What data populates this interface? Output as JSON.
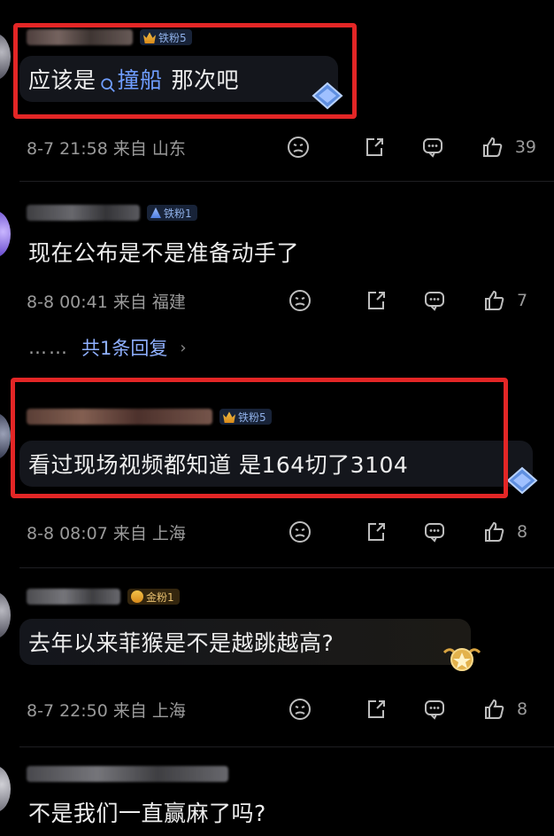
{
  "comments": [
    {
      "badge": "铁粉5",
      "text_before": "应该是",
      "link_text": "撞船",
      "text_after": "那次吧",
      "meta": "8-7 21:58  来自 山东",
      "likes": "39"
    },
    {
      "badge": "铁粉1",
      "text": "现在公布是不是准备动手了",
      "meta": "8-8 00:41  来自 福建",
      "likes": "7",
      "replies_dots": "……",
      "replies_label": "共1条回复",
      "replies_chevron": "›"
    },
    {
      "badge": "铁粉5",
      "text": "看过现场视频都知道 是164切了3104",
      "meta": "8-8 08:07  来自 上海",
      "likes": "8"
    },
    {
      "badge": "金粉1",
      "text": "去年以来菲猴是不是越跳越高?",
      "meta": "8-7 22:50  来自 上海",
      "likes": "8"
    },
    {
      "text": "不是我们一直赢麻了吗?"
    }
  ],
  "icons": {
    "emoji": "face-emoji-icon",
    "share": "share-icon",
    "reply": "comment-icon",
    "like": "thumbs-up-icon",
    "search": "search-icon"
  },
  "colors": {
    "background": "#000000",
    "link": "#6f9dff",
    "highlight": "#e32626",
    "meta": "#9a9a9a"
  }
}
